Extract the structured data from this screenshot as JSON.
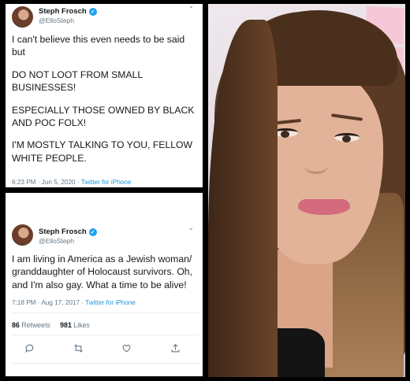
{
  "tweets": [
    {
      "name": "Steph Frosch",
      "handle": "@ElloSteph",
      "paragraphs": [
        "I can't believe this even needs to be said but",
        "DO NOT LOOT FROM SMALL BUSINESSES!",
        "ESPECIALLY THOSE OWNED BY BLACK AND POC FOLX!",
        "I'M MOSTLY TALKING TO YOU, FELLOW WHITE PEOPLE."
      ],
      "time": "6:23 PM · Jun 5, 2020 · ",
      "source": "Twitter for iPhone"
    },
    {
      "name": "Steph Frosch",
      "handle": "@ElloSteph",
      "paragraphs": [
        "I am living in America as a Jewish woman/ granddaughter of Holocaust survivors. Oh, and I'm also gay. What a time to be alive!"
      ],
      "time": "7:18 PM · Aug 17, 2017 · ",
      "source": "Twitter for iPhone",
      "retweets": "86",
      "retweets_label": "Retweets",
      "likes": "981",
      "likes_label": "Likes"
    }
  ],
  "icons": {
    "verified": "✓",
    "chevron": "⌄"
  },
  "colors": {
    "verified": "#1da1f2",
    "link": "#1b95e0",
    "muted": "#657786",
    "text": "#14171a"
  }
}
